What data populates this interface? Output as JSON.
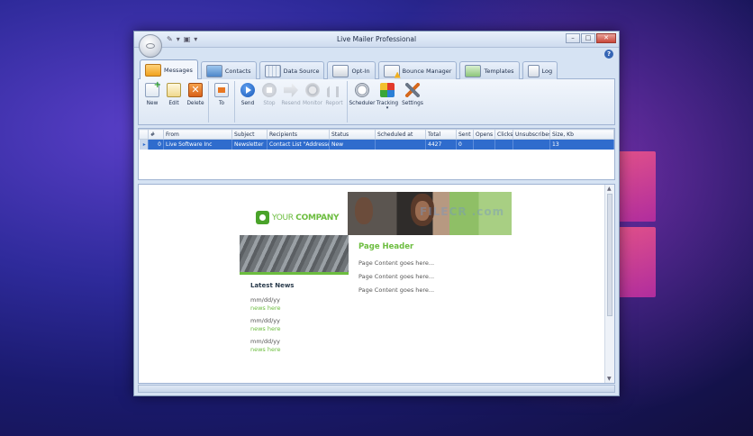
{
  "window": {
    "title": "Live Mailer Professional"
  },
  "tabs": [
    {
      "label": "Messages",
      "icon": "messages-icon"
    },
    {
      "label": "Contacts",
      "icon": "contacts-icon"
    },
    {
      "label": "Data Source",
      "icon": "data-source-icon"
    },
    {
      "label": "Opt-In",
      "icon": "opt-in-icon"
    },
    {
      "label": "Bounce Manager",
      "icon": "bounce-manager-icon"
    },
    {
      "label": "Templates",
      "icon": "templates-icon"
    },
    {
      "label": "Log",
      "icon": "log-icon"
    }
  ],
  "ribbon": {
    "new": "New",
    "edit": "Edit",
    "delete": "Delete",
    "to": "To",
    "send": "Send",
    "stop": "Stop",
    "resend": "Resend",
    "monitor": "Monitor",
    "report": "Report",
    "scheduler": "Scheduler",
    "tracking": "Tracking",
    "settings": "Settings"
  },
  "grid": {
    "columns": [
      "#",
      "From",
      "Subject",
      "Recipients",
      "Status",
      "Scheduled at",
      "Total",
      "Sent",
      "Opens",
      "Clicks",
      "Unsubscribes",
      "Size, Kb"
    ],
    "rows": [
      {
        "num": "0",
        "from": "Live Software Inc",
        "subject": "Newsletter",
        "recipients": "Contact List \"Addresses\"",
        "status": "New",
        "scheduled": "",
        "total": "4427",
        "sent": "0",
        "opens": "",
        "clicks": "",
        "unsubscribes": "",
        "size": "13"
      }
    ]
  },
  "preview": {
    "logo_text_1": "YOUR",
    "logo_text_2": "COMPANY",
    "watermark": "FILECR .com",
    "latest_news": "Latest News",
    "news": [
      {
        "date": "mm/dd/yy",
        "text": "news here"
      },
      {
        "date": "mm/dd/yy",
        "text": "news here"
      },
      {
        "date": "mm/dd/yy",
        "text": "news here"
      }
    ],
    "page_header": "Page Header",
    "page_lines": [
      "Page Content goes here...",
      "Page Content goes here...",
      "Page Content goes here..."
    ]
  },
  "colors": {
    "accent_green": "#6cbd3f",
    "selection_blue": "#2f6ccd"
  }
}
